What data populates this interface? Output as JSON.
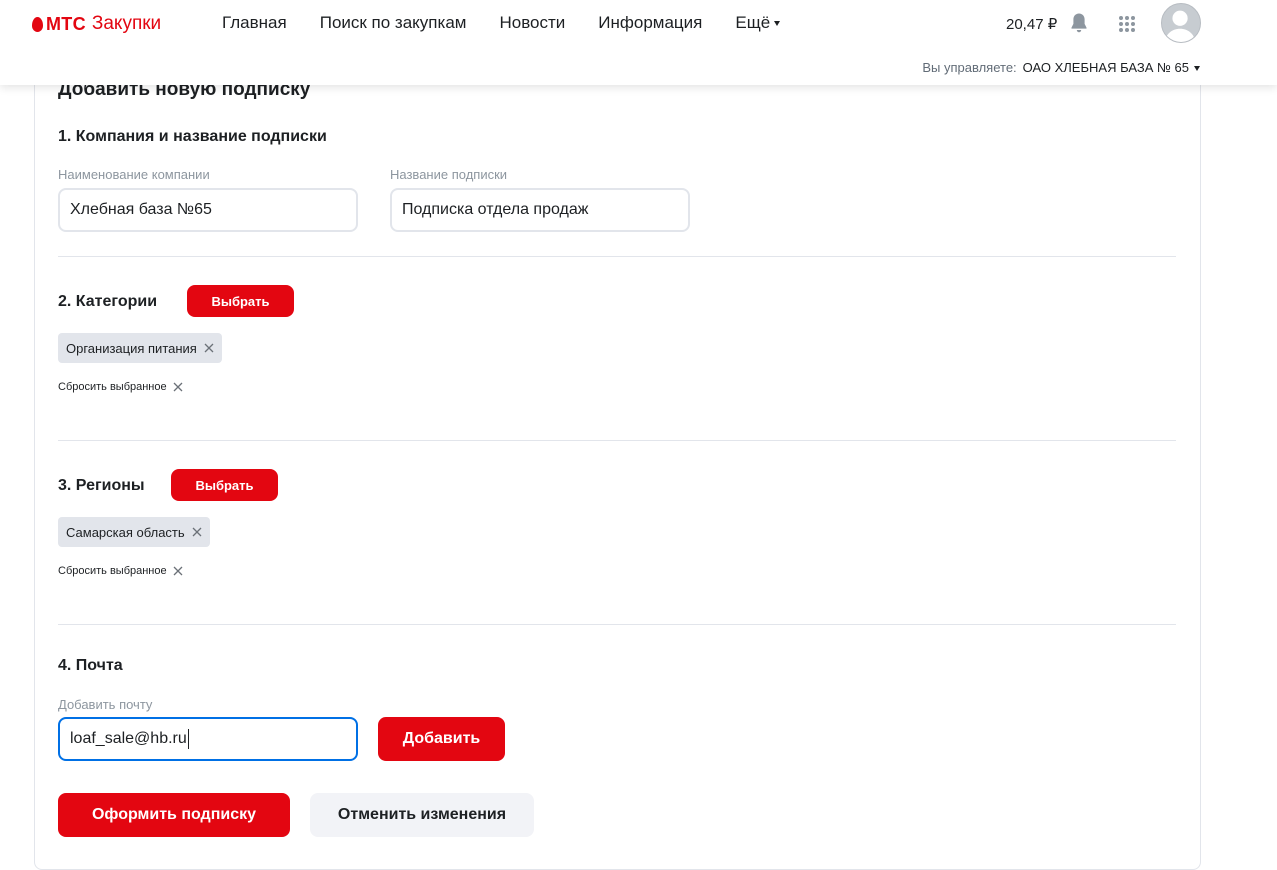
{
  "header": {
    "logo_brand": "МТС",
    "logo_product": "Закупки",
    "nav": [
      {
        "label": "Главная"
      },
      {
        "label": "Поиск по закупкам"
      },
      {
        "label": "Новости"
      },
      {
        "label": "Информация"
      },
      {
        "label": "Ещё"
      }
    ],
    "balance": "20,47 ₽",
    "manage_label": "Вы управляете:",
    "manage_value": "ОАО ХЛЕБНАЯ БАЗА № 65"
  },
  "form": {
    "title": "Добавить новую подписку",
    "section1": {
      "title": "1. Компания и название подписки",
      "company_label": "Наименование компании",
      "company_value": "Хлебная база №65",
      "name_label": "Название подписки",
      "name_value": "Подписка отдела продаж"
    },
    "section2": {
      "title": "2. Категории",
      "choose_label": "Выбрать",
      "chips": [
        "Организация питания"
      ],
      "reset_label": "Сбросить выбранное"
    },
    "section3": {
      "title": "3. Регионы",
      "choose_label": "Выбрать",
      "chips": [
        "Самарская область"
      ],
      "reset_label": "Сбросить выбранное"
    },
    "section4": {
      "title": "4. Почта",
      "email_label": "Добавить почту",
      "email_value": "loaf_sale@hb.ru",
      "add_label": "Добавить"
    },
    "submit_label": "Оформить подписку",
    "cancel_label": "Отменить изменения"
  },
  "colors": {
    "brand_red": "#e30611",
    "focus_blue": "#0070e5",
    "chip_bg": "#e2e5eb",
    "text": "#1d2023",
    "muted": "#8d969f"
  },
  "icons": [
    "mts-egg-icon",
    "bell-icon",
    "apps-grid-icon",
    "avatar-icon",
    "chevron-down-icon",
    "close-icon"
  ]
}
